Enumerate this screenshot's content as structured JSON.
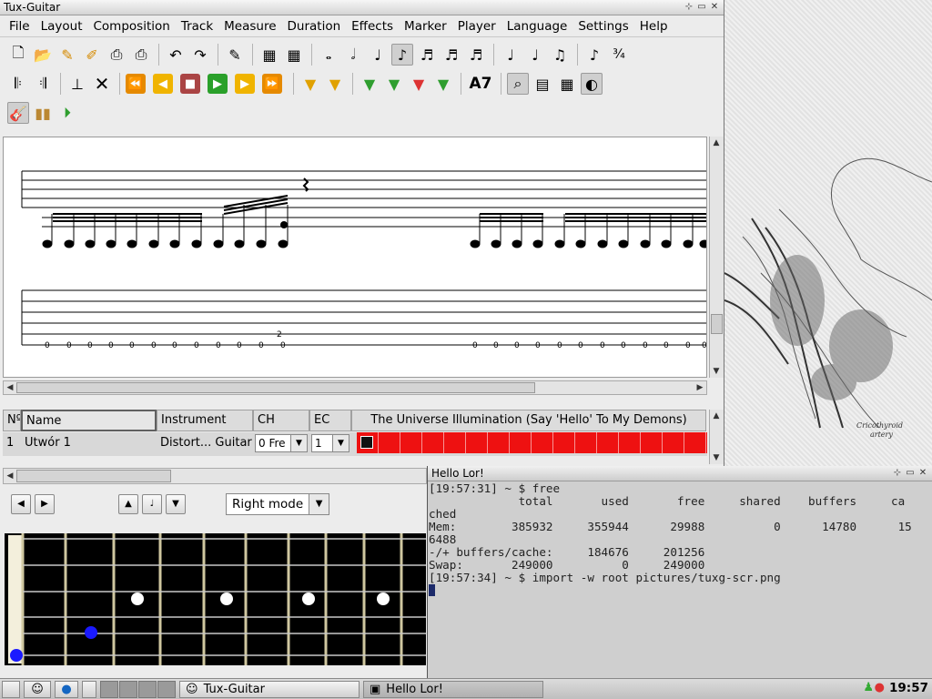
{
  "tuxguitar": {
    "title": "Tux-Guitar",
    "menu": [
      "File",
      "Layout",
      "Composition",
      "Track",
      "Measure",
      "Duration",
      "Effects",
      "Marker",
      "Player",
      "Language",
      "Settings",
      "Help"
    ],
    "chord_label": "A7",
    "tab_digits": {
      "row1_mark": "2"
    },
    "tracks": {
      "headers": {
        "num": "Nº",
        "name": "Name",
        "instrument": "Instrument",
        "ch": "CH",
        "ec": "EC"
      },
      "song_title": "The Universe Illumination (Say 'Hello' To My Demons)",
      "rows": [
        {
          "num": "1",
          "name": "Utwór 1",
          "instrument": "Distort... Guitar",
          "ch": "0 Fre",
          "ec": "1"
        }
      ]
    },
    "fretboard": {
      "mode": "Right mode"
    }
  },
  "terminal": {
    "title": "Hello Lor!",
    "lines": [
      "[19:57:31] ~ $ free",
      "             total       used       free     shared    buffers     ca",
      "ched",
      "Mem:        385932     355944      29988          0      14780      15",
      "6488",
      "-/+ buffers/cache:     184676     201256",
      "Swap:       249000          0     249000",
      "[19:57:34] ~ $ import -w root pictures/tuxg-scr.png"
    ]
  },
  "taskbar": {
    "tasks": [
      "Tux-Guitar",
      "Hello Lor!"
    ],
    "clock": "19:57"
  },
  "colors": {
    "timeline": "#ee1111",
    "fret_marker": "#1a1aff"
  }
}
